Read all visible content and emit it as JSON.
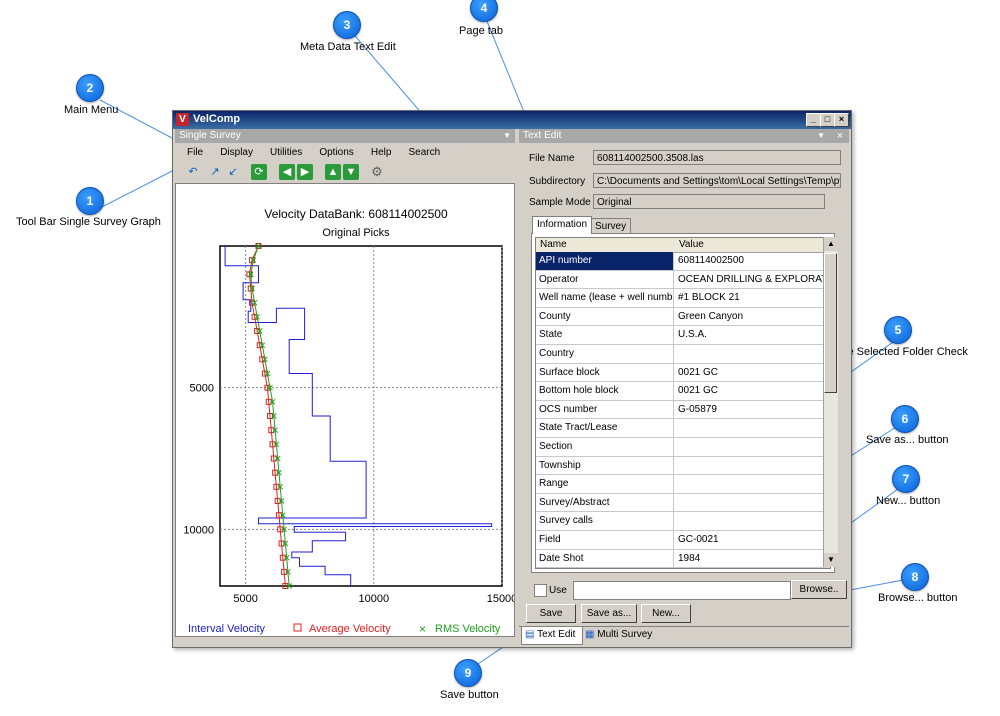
{
  "callouts": [
    {
      "num": "1",
      "label": "Tool Bar Single Survey Graph"
    },
    {
      "num": "2",
      "label": "Main Menu"
    },
    {
      "num": "3",
      "label": "Meta Data Text Edit"
    },
    {
      "num": "4",
      "label": "Page tab"
    },
    {
      "num": "5",
      "label": "Use Selected Folder Check"
    },
    {
      "num": "6",
      "label": "Save as... button"
    },
    {
      "num": "7",
      "label": "New... button"
    },
    {
      "num": "8",
      "label": "Browse... button"
    },
    {
      "num": "9",
      "label": "Save button"
    }
  ],
  "window": {
    "title": "VelComp",
    "min": "_",
    "max": "□",
    "close": "×"
  },
  "left_pane": {
    "header": "Single Survey",
    "menu": [
      "File",
      "Display",
      "Utilities",
      "Options",
      "Help",
      "Search"
    ]
  },
  "right_pane": {
    "header": "Text Edit",
    "fields": [
      {
        "label": "File Name",
        "value": "608114002500.3508.las"
      },
      {
        "label": "Subdirectory",
        "value": "C:\\Documents and Settings\\tom\\Local Settings\\Temp\\pyzry9"
      },
      {
        "label": "Sample Mode",
        "value": "Original"
      }
    ],
    "tabs": [
      "Information",
      "Survey"
    ],
    "columns": [
      "Name",
      "Value"
    ],
    "rows": [
      {
        "name": "API number",
        "value": "608114002500"
      },
      {
        "name": "Operator",
        "value": "OCEAN DRILLING & EXPLORATION"
      },
      {
        "name": "Well name (lease + well number)",
        "value": "#1 BLOCK 21"
      },
      {
        "name": "County",
        "value": "Green Canyon"
      },
      {
        "name": "State",
        "value": "U.S.A."
      },
      {
        "name": "Country",
        "value": ""
      },
      {
        "name": "Surface block",
        "value": "0021 GC"
      },
      {
        "name": "Bottom hole block",
        "value": "0021 GC"
      },
      {
        "name": "OCS number",
        "value": "G-05879"
      },
      {
        "name": "State Tract/Lease",
        "value": ""
      },
      {
        "name": "Section",
        "value": ""
      },
      {
        "name": "Township",
        "value": ""
      },
      {
        "name": "Range",
        "value": ""
      },
      {
        "name": "Survey/Abstract",
        "value": ""
      },
      {
        "name": "Survey calls",
        "value": ""
      },
      {
        "name": "Field",
        "value": "GC-0021"
      },
      {
        "name": "Date Shot",
        "value": "1984"
      }
    ],
    "use_label": "Use",
    "browse_label": "Browse..",
    "save_label": "Save",
    "save_as_label": "Save as...",
    "new_label": "New...",
    "bottom_tabs": [
      "Text Edit",
      "Multi Survey"
    ]
  },
  "colors": {
    "interval": "#2020d0",
    "average": "#e02020",
    "rms": "#20a020"
  },
  "chart_data": {
    "type": "line",
    "title": "Velocity DataBank: 608114002500",
    "subtitle": "Original Picks",
    "xlim": [
      4000,
      15000
    ],
    "ylim": [
      0,
      12000
    ],
    "x_ticks": [
      5000,
      10000,
      15000
    ],
    "y_ticks": [
      5000,
      10000
    ],
    "y_inverted": true,
    "grid": true,
    "legend": [
      "Interval Velocity",
      "Average Velocity",
      "RMS Velocity"
    ],
    "series": [
      {
        "name": "Interval Velocity",
        "style": "step",
        "x": [
          4200,
          4200,
          5500,
          5500,
          4900,
          4900,
          5200,
          5200,
          5100,
          5100,
          6200,
          6200,
          7300,
          7300,
          6700,
          6700,
          7600,
          7600,
          8300,
          8300,
          9700,
          9700,
          5500,
          5500,
          14600,
          14600,
          6900,
          6900,
          8900,
          8900,
          7600,
          7600,
          6800,
          6800,
          7100,
          7100,
          8100,
          8100,
          9100,
          9100
        ],
        "y": [
          0,
          700,
          700,
          1300,
          1300,
          1900,
          1900,
          2300,
          2300,
          2700,
          2700,
          2200,
          2200,
          3300,
          3300,
          4500,
          4500,
          6000,
          6000,
          7600,
          7600,
          9600,
          9600,
          9800,
          9800,
          9900,
          9900,
          10100,
          10100,
          10400,
          10400,
          10800,
          10800,
          11000,
          11000,
          11300,
          11300,
          11600,
          11600,
          12000
        ]
      },
      {
        "name": "Average Velocity",
        "style": "markers-square",
        "x": [
          5500,
          5250,
          5150,
          5200,
          5250,
          5350,
          5450,
          5550,
          5650,
          5750,
          5850,
          5900,
          5950,
          6000,
          6050,
          6100,
          6150,
          6200,
          6250,
          6300,
          6350,
          6400,
          6450,
          6500,
          6550
        ],
        "y": [
          0,
          500,
          1000,
          1500,
          2000,
          2500,
          3000,
          3500,
          4000,
          4500,
          5000,
          5500,
          6000,
          6500,
          7000,
          7500,
          8000,
          8500,
          9000,
          9500,
          10000,
          10500,
          11000,
          11500,
          12000
        ]
      },
      {
        "name": "RMS Velocity",
        "style": "markers-x",
        "x": [
          5500,
          5300,
          5200,
          5250,
          5350,
          5450,
          5550,
          5650,
          5750,
          5850,
          5950,
          6050,
          6100,
          6150,
          6200,
          6250,
          6300,
          6350,
          6400,
          6450,
          6500,
          6550,
          6600,
          6650,
          6700
        ],
        "y": [
          0,
          500,
          1000,
          1500,
          2000,
          2500,
          3000,
          3500,
          4000,
          4500,
          5000,
          5500,
          6000,
          6500,
          7000,
          7500,
          8000,
          8500,
          9000,
          9500,
          10000,
          10500,
          11000,
          11500,
          12000
        ]
      }
    ]
  }
}
